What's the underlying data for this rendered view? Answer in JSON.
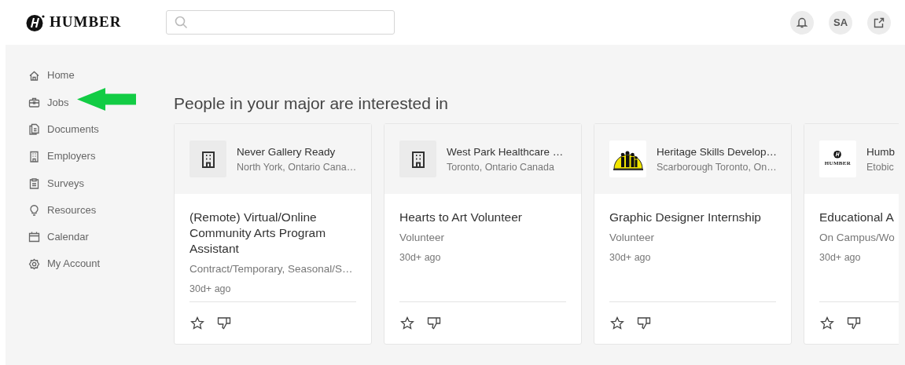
{
  "header": {
    "brand": "HUMBER",
    "avatar": "SA"
  },
  "sidebar": {
    "items": [
      {
        "label": "Home"
      },
      {
        "label": "Jobs"
      },
      {
        "label": "Documents"
      },
      {
        "label": "Employers"
      },
      {
        "label": "Surveys"
      },
      {
        "label": "Resources"
      },
      {
        "label": "Calendar"
      },
      {
        "label": "My Account"
      }
    ]
  },
  "section_title": "People in your major are interested in",
  "cards": [
    {
      "employer": "Never Gallery Ready",
      "location": "North York, Ontario Cana…",
      "logo": {
        "kind": "building"
      },
      "title": "(Remote) Virtual/Online Community Arts Program Assistant",
      "job_type": "Contract/Temporary, Seasonal/S…",
      "posted": "30d+ ago"
    },
    {
      "employer": "West Park Healthcare …",
      "location": "Toronto, Ontario Canada",
      "logo": {
        "kind": "building"
      },
      "title": "Hearts to Art Volunteer",
      "job_type": "Volunteer",
      "posted": "30d+ ago"
    },
    {
      "employer": "Heritage Skills Develop…",
      "location": "Scarborough Toronto, On…",
      "logo": {
        "kind": "emblem"
      },
      "title": "Graphic Designer Internship",
      "job_type": "Volunteer",
      "posted": "30d+ ago"
    },
    {
      "employer": "Humb",
      "location": "Etobic",
      "logo": {
        "kind": "wordmark",
        "text": "HUMBER"
      },
      "title": "Educational A",
      "job_type": "On Campus/Wo",
      "posted": "30d+ ago"
    }
  ]
}
